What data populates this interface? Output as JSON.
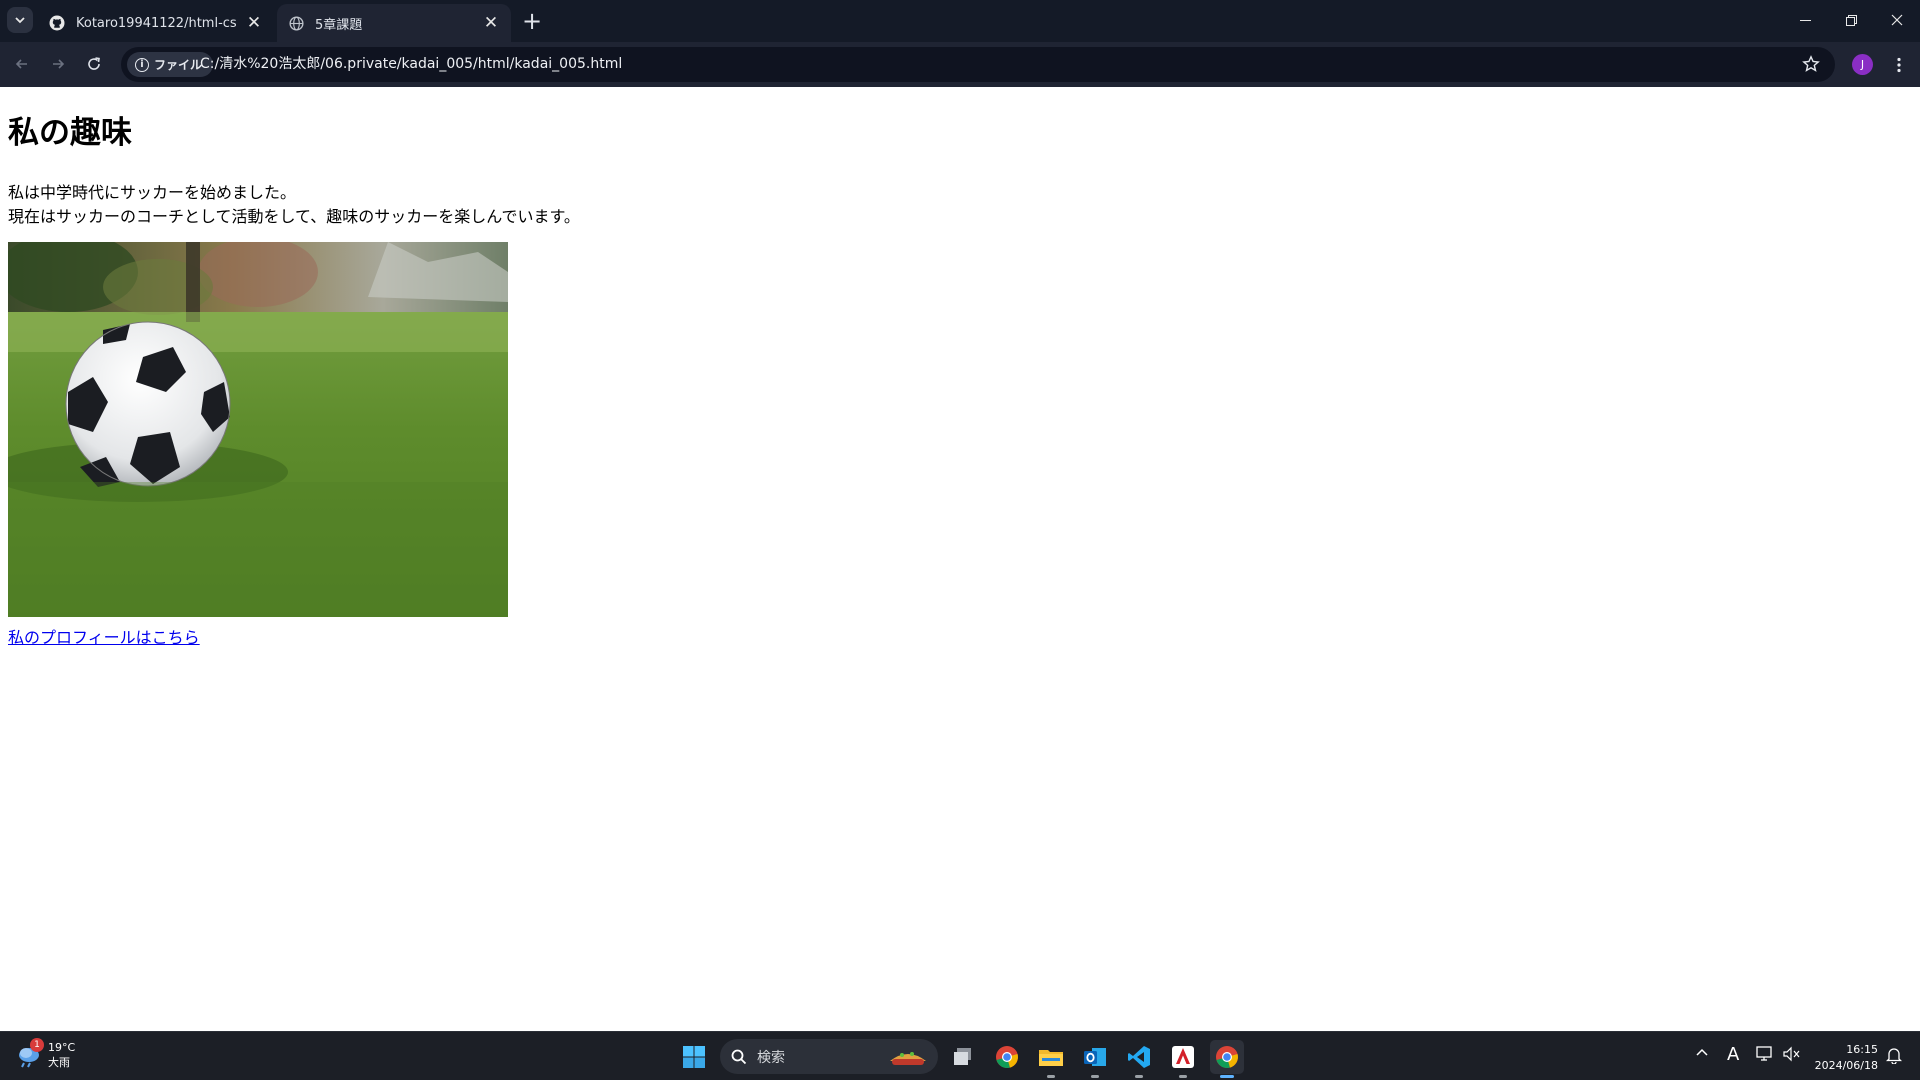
{
  "browser": {
    "tabs": [
      {
        "title": "Kotaro19941122/html-css-basic",
        "favicon": "github-icon",
        "active": false
      },
      {
        "title": "5章課題",
        "favicon": "globe-icon",
        "active": true
      }
    ],
    "address_chip": "ファイル",
    "url": "C:/清水%20浩太郎/06.private/kadai_005/html/kadai_005.html",
    "profile_initial": "J"
  },
  "page": {
    "heading": "私の趣味",
    "paragraph_lines": [
      "私は中学時代にサッカーを始めました。",
      "現在はサッカーのコーチとして活動をして、趣味のサッカーを楽しんでいます。"
    ],
    "image_subject": "soccer ball on grass",
    "link_text": "私のプロフィールはこちら"
  },
  "taskbar": {
    "weather_temp": "19°C",
    "weather_desc": "大雨",
    "weather_badge": "1",
    "search_placeholder": "検索",
    "apps": [
      "start-icon",
      "task-view-icon",
      "chrome-icon",
      "file-explorer-icon",
      "outlook-icon",
      "vscode-icon",
      "acrobat-icon",
      "chrome-active-icon"
    ],
    "clock_time": "16:15",
    "clock_date": "2024/06/18",
    "ime": "A"
  },
  "colors": {
    "chrome_bg": "#1f2433",
    "tabstrip_bg": "#141a27",
    "link": "#0000ee",
    "taskbar_bg": "#1c1f26"
  }
}
